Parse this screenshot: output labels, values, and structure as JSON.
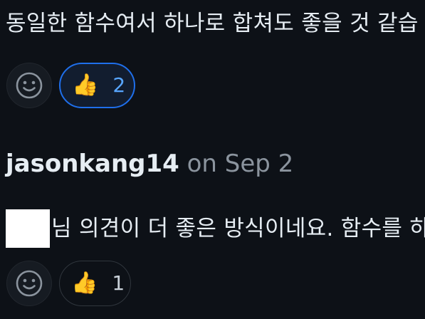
{
  "comment1": {
    "text": "동일한 함수여서 하나로 합쳐도 좋을 것 같습",
    "reactions": {
      "add_icon": "smiley-icon",
      "thumbs_up": {
        "emoji": "👍",
        "count": "2",
        "reacted_by_user": true
      }
    }
  },
  "comment2": {
    "author": "jasonkang14",
    "on_label": "on",
    "date": "Sep 2",
    "text": "님 의견이 더 좋은 방식이네요. 함수를 하",
    "reactions": {
      "add_icon": "smiley-icon",
      "thumbs_up": {
        "emoji": "👍",
        "count": "1",
        "reacted_by_user": false
      }
    }
  },
  "colors": {
    "background": "#0d1117",
    "accent": "#1f6feb",
    "count_active": "#58a6ff",
    "muted": "#8b949e"
  }
}
